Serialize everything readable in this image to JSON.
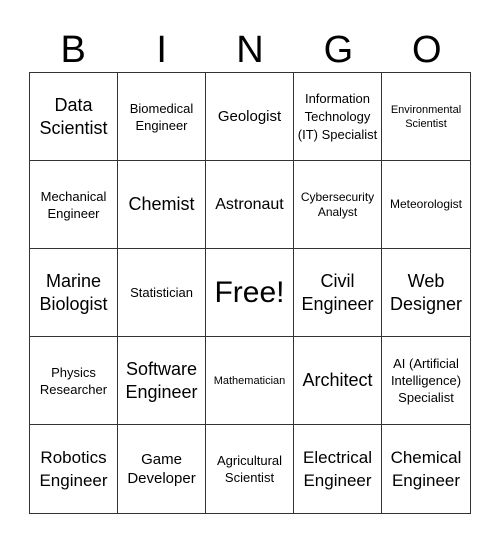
{
  "header": {
    "letters": [
      "B",
      "I",
      "N",
      "G",
      "O"
    ]
  },
  "cells": [
    [
      "Data Scientist",
      "Biomedical Engineer",
      "Geologist",
      "Information Technology (IT) Specialist",
      "Environmental Scientist"
    ],
    [
      "Mechanical Engineer",
      "Chemist",
      "Astronaut",
      "Cybersecurity Analyst",
      "Meteorologist"
    ],
    [
      "Marine Biologist",
      "Statistician",
      "Free!",
      "Civil Engineer",
      "Web Designer"
    ],
    [
      "Physics Researcher",
      "Software Engineer",
      "Mathematician",
      "Architect",
      "AI (Artificial Intelligence) Specialist"
    ],
    [
      "Robotics Engineer",
      "Game Developer",
      "Agricultural Scientist",
      "Electrical Engineer",
      "Chemical Engineer"
    ]
  ]
}
